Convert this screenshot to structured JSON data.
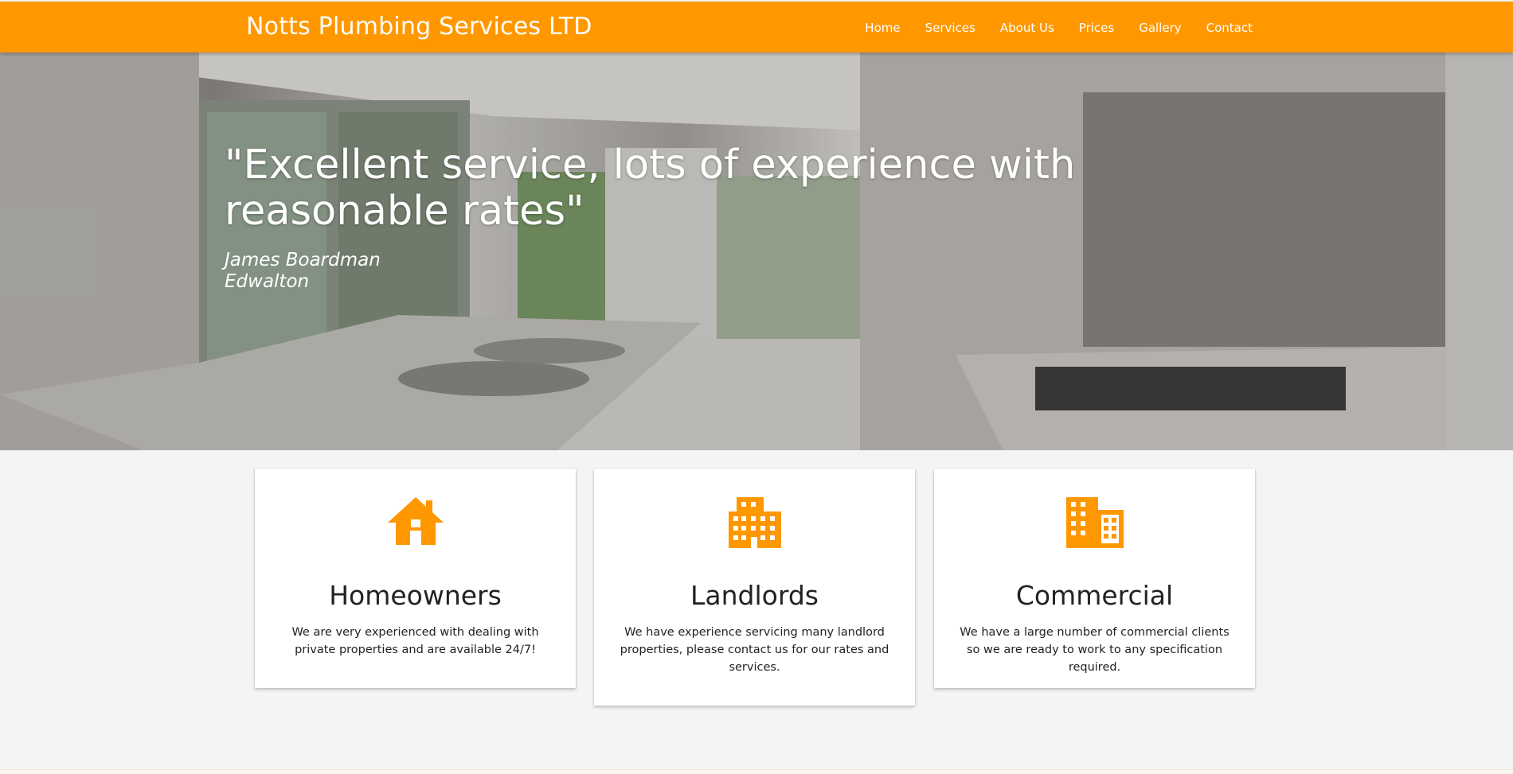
{
  "header": {
    "brand": "Notts Plumbing Services LTD",
    "nav": [
      "Home",
      "Services",
      "About Us",
      "Prices",
      "Gallery",
      "Contact"
    ]
  },
  "hero": {
    "quote": "\"Excellent service, lots of experience with reasonable rates\"",
    "author_name": "James Boardman",
    "author_location": "Edwalton"
  },
  "cards": [
    {
      "icon": "house-icon",
      "title": "Homeowners",
      "text": "We are very experienced with dealing with private properties and are available 24/7!"
    },
    {
      "icon": "apartment-building-icon",
      "title": "Landlords",
      "text": "We have experience servicing many landlord properties, please contact us for our rates and services."
    },
    {
      "icon": "office-building-icon",
      "title": "Commercial",
      "text": "We have a large number of commercial clients so we are ready to work to any specification required."
    }
  ],
  "colors": {
    "accent": "#ff9800",
    "card_bg": "#ffffff",
    "page_bg": "#f4f4f4"
  }
}
